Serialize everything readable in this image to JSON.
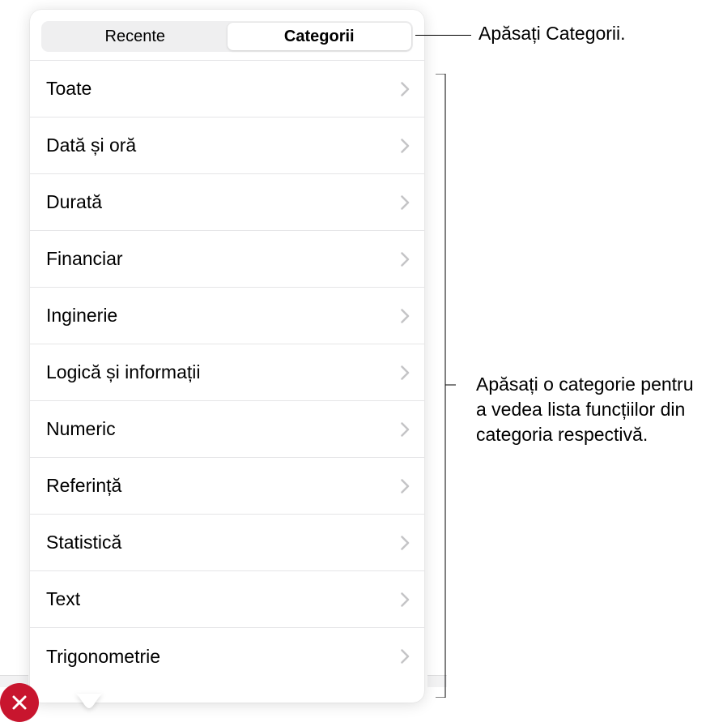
{
  "tabs": {
    "recent_label": "Recente",
    "categories_label": "Categorii"
  },
  "categories": [
    {
      "label": "Toate"
    },
    {
      "label": "Dată și oră"
    },
    {
      "label": "Durată"
    },
    {
      "label": "Financiar"
    },
    {
      "label": "Inginerie"
    },
    {
      "label": "Logică și informații"
    },
    {
      "label": "Numeric"
    },
    {
      "label": "Referință"
    },
    {
      "label": "Statistică"
    },
    {
      "label": "Text"
    },
    {
      "label": "Trigonometrie"
    }
  ],
  "callouts": {
    "top": "Apăsați Categorii.",
    "mid": "Apăsați o categorie pentru a vedea lista funcțiilor din categoria respectivă."
  }
}
